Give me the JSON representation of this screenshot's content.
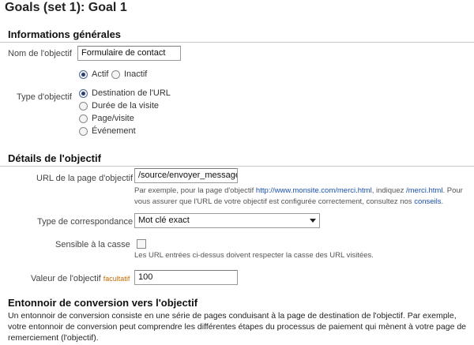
{
  "page": {
    "title": "Goals (set 1): Goal 1"
  },
  "general": {
    "heading": "Informations générales",
    "name_label": "Nom de l'objectif",
    "name_value": "Formulaire de contact",
    "status_options": [
      "Actif",
      "Inactif"
    ],
    "status_selected": "Actif",
    "type_label": "Type d'objectif",
    "type_options": [
      "Destination de l'URL",
      "Durée de la visite",
      "Page/visite",
      "Événement"
    ],
    "type_selected": "Destination de l'URL"
  },
  "details": {
    "heading": "Détails de l'objectif",
    "url_label": "URL de la page d'objectif",
    "url_value": "/source/envoyer_message",
    "url_help_part1": "Par exemple, pour la page d'objectif ",
    "url_help_link1": "http://www.monsite.com/merci.html",
    "url_help_part2": ", indiquez ",
    "url_help_link2": "/merci.html",
    "url_help_part3": ". Pour vous assurer que l'URL de votre objectif est configurée correctement, consultez nos ",
    "url_help_link3": "conseils",
    "url_help_part4": ".",
    "match_label": "Type de correspondance",
    "match_value": "Mot clé exact",
    "case_label": "Sensible à la casse",
    "case_checked": false,
    "case_help": "Les URL entrées ci-dessus doivent respecter la casse des URL visitées.",
    "value_label": "Valeur de l'objectif",
    "value_optional": "facultatif",
    "value_value": "100"
  },
  "funnel": {
    "heading": "Entonnoir de conversion vers l'objectif",
    "description": "Un entonnoir de conversion consiste en une série de pages conduisant à la page de destination de l'objectif. Par exemple, votre entonnoir de conversion peut comprendre les différentes étapes du processus de paiement qui mènent à votre page de remerciement (l'objectif)."
  }
}
